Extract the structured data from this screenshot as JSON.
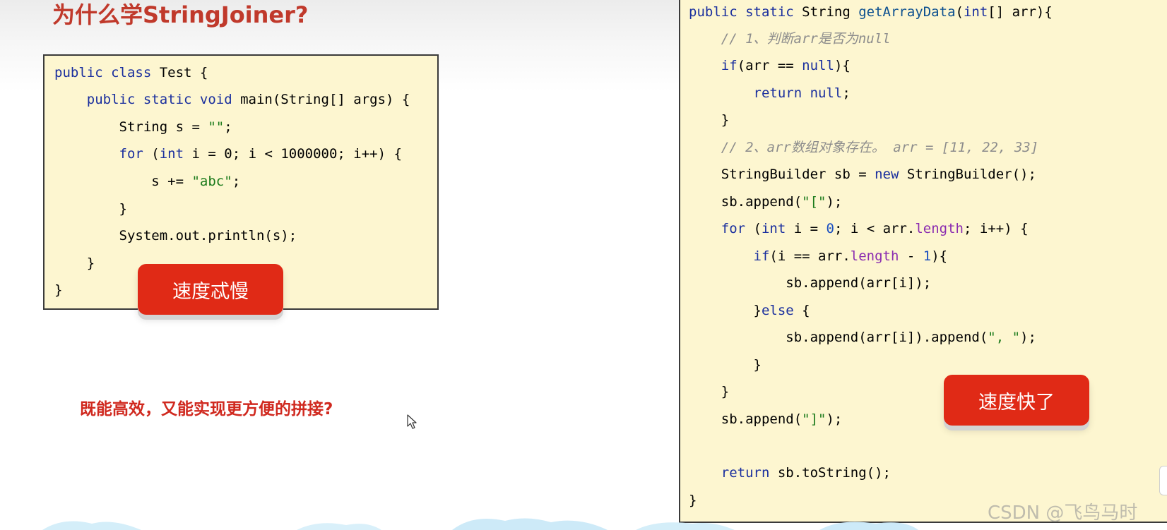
{
  "slide": {
    "title": "为什么学StringJoiner?",
    "question": "既能高效，又能实现更方便的拼接?",
    "watermark": "CSDN @飞鸟马时"
  },
  "left_code": {
    "lines": [
      "public class Test {",
      "    public static void main(String[] args) {",
      "        String s = \"\";",
      "        for (int i = 0; i < 1000000; i++) {",
      "            s += \"abc\";",
      "        }",
      "        System.out.println(s);",
      "    }",
      "}"
    ],
    "badge_label": "速度忒慢"
  },
  "right_code": {
    "lines": [
      "public static String getArrayData(int[] arr){",
      "    // 1、判断arr是否为null",
      "    if(arr == null){",
      "        return null;",
      "    }",
      "    // 2、arr数组对象存在。 arr = [11, 22, 33]",
      "    StringBuilder sb = new StringBuilder();",
      "    sb.append(\"[\");",
      "    for (int i = 0; i < arr.length; i++) {",
      "        if(i == arr.length - 1){",
      "            sb.append(arr[i]);",
      "        }else {",
      "            sb.append(arr[i]).append(\", \");",
      "        }",
      "    }",
      "    sb.append(\"]\");",
      "",
      "    return sb.toString();",
      "}"
    ],
    "badge_label": "速度快了"
  },
  "colors": {
    "title": "#c0392b",
    "badge": "#e02a16",
    "code_bg": "#fdf6d0",
    "keyword": "#1a2f9e",
    "string": "#1a7a1a",
    "comment": "#8c8c8c",
    "field": "#8a2bb0"
  },
  "icons": {
    "cursor": "mouse-pointer-icon"
  }
}
